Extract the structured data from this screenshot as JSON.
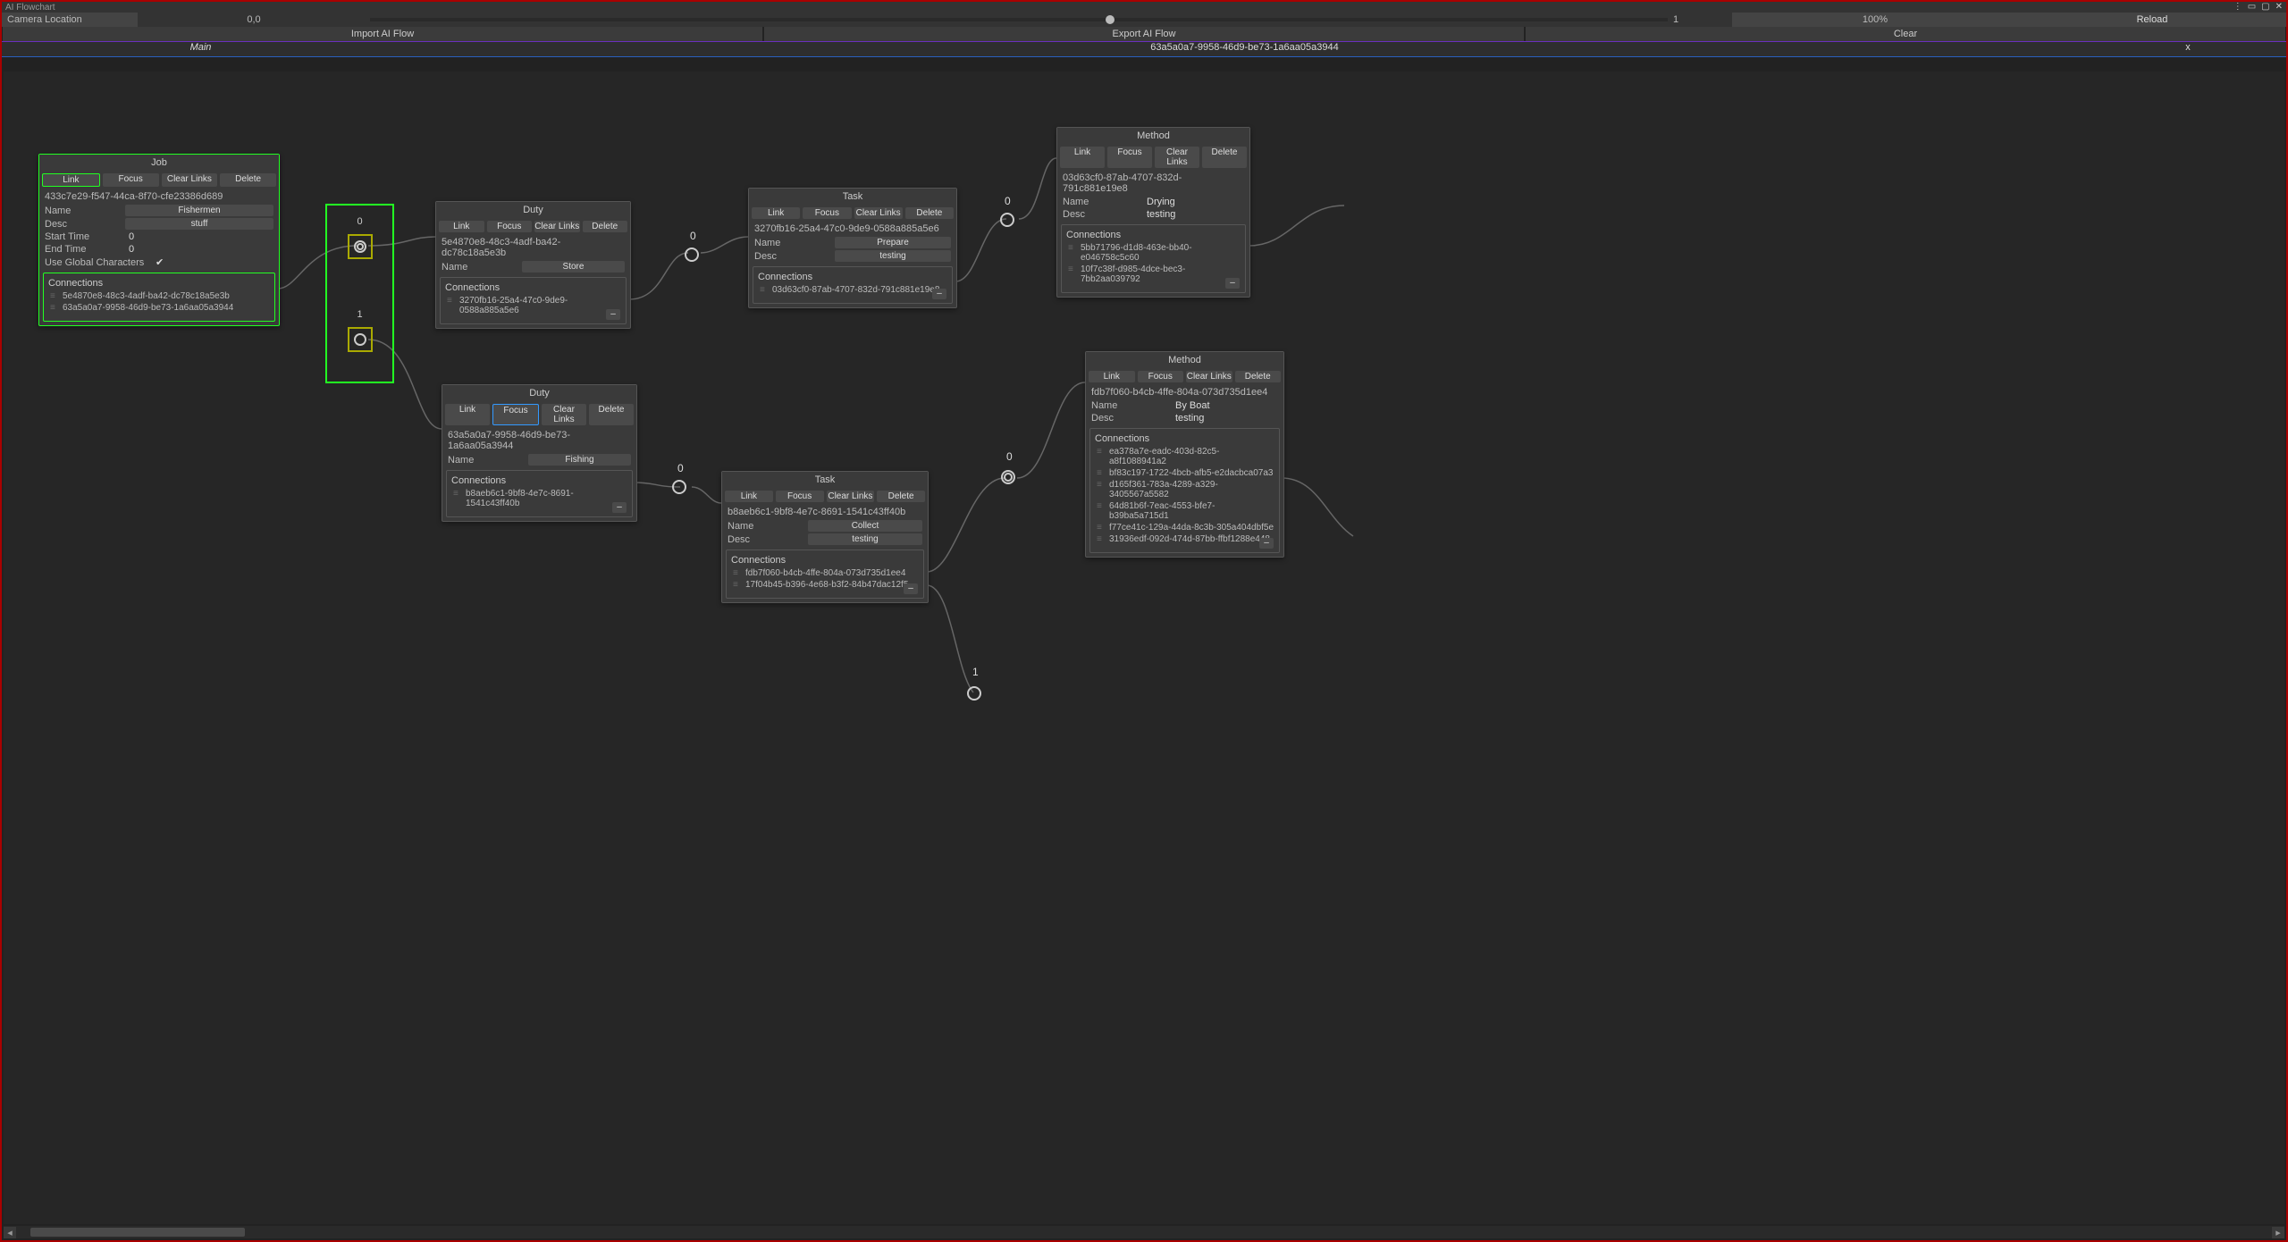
{
  "window_title": "AI Flowchart",
  "camera": {
    "label": "Camera Location",
    "value": "0,0"
  },
  "zoom": {
    "slider_value": "1",
    "percent": "100%",
    "reload": "Reload"
  },
  "io": {
    "import": "Import AI Flow",
    "export": "Export AI Flow",
    "clear": "Clear"
  },
  "crumbs": {
    "main": "Main",
    "active_id": "63a5a0a7-9958-46d9-be73-1a6aa05a3944",
    "close": "x"
  },
  "labels": {
    "connections": "Connections",
    "name": "Name",
    "desc": "Desc",
    "start": "Start Time",
    "end": "End Time",
    "useg": "Use Global Characters",
    "link": "Link",
    "focus": "Focus",
    "clearlinks": "Clear Links",
    "delete": "Delete",
    "minus": "–"
  },
  "ord": {
    "top": "0",
    "bot": "1"
  },
  "ports": {
    "duty1": "0",
    "task1": "0",
    "method1": "0",
    "duty2": "0",
    "method2": "0",
    "task2_bot": "1"
  },
  "nodes": {
    "job": {
      "title": "Job",
      "id": "433c7e29-f547-44ca-8f70-cfe23386d689",
      "name": "Fishermen",
      "desc": "stuff",
      "start": "0",
      "end": "0",
      "useg": "✔",
      "conns": [
        "5e4870e8-48c3-4adf-ba42-dc78c18a5e3b",
        "63a5a0a7-9958-46d9-be73-1a6aa05a3944"
      ]
    },
    "duty1": {
      "title": "Duty",
      "id": "5e4870e8-48c3-4adf-ba42-dc78c18a5e3b",
      "name": "Store",
      "conns": [
        "3270fb16-25a4-47c0-9de9-0588a885a5e6"
      ]
    },
    "task1": {
      "title": "Task",
      "id": "3270fb16-25a4-47c0-9de9-0588a885a5e6",
      "name": "Prepare",
      "desc": "testing",
      "conns": [
        "03d63cf0-87ab-4707-832d-791c881e19e8"
      ]
    },
    "method1": {
      "title": "Method",
      "id": "03d63cf0-87ab-4707-832d-791c881e19e8",
      "name": "Drying",
      "desc": "testing",
      "conns": [
        "5bb71796-d1d8-463e-bb40-e046758c5c60",
        "10f7c38f-d985-4dce-bec3-7bb2aa039792"
      ]
    },
    "duty2": {
      "title": "Duty",
      "id": "63a5a0a7-9958-46d9-be73-1a6aa05a3944",
      "name": "Fishing",
      "conns": [
        "b8aeb6c1-9bf8-4e7c-8691-1541c43ff40b"
      ]
    },
    "task2": {
      "title": "Task",
      "id": "b8aeb6c1-9bf8-4e7c-8691-1541c43ff40b",
      "name": "Collect",
      "desc": "testing",
      "conns": [
        "fdb7f060-b4cb-4ffe-804a-073d735d1ee4",
        "17f04b45-b396-4e68-b3f2-84b47dac12f5"
      ]
    },
    "method2": {
      "title": "Method",
      "id": "fdb7f060-b4cb-4ffe-804a-073d735d1ee4",
      "name": "By Boat",
      "desc": "testing",
      "conns": [
        "ea378a7e-eadc-403d-82c5-a8f1088941a2",
        "bf83c197-1722-4bcb-afb5-e2dacbca07a3",
        "d165f361-783a-4289-a329-3405567a5582",
        "64d81b6f-7eac-4553-bfe7-b39ba5a715d1",
        "f77ce41c-129a-44da-8c3b-305a404dbf5e",
        "31936edf-092d-474d-87bb-ffbf1288e448"
      ]
    }
  }
}
